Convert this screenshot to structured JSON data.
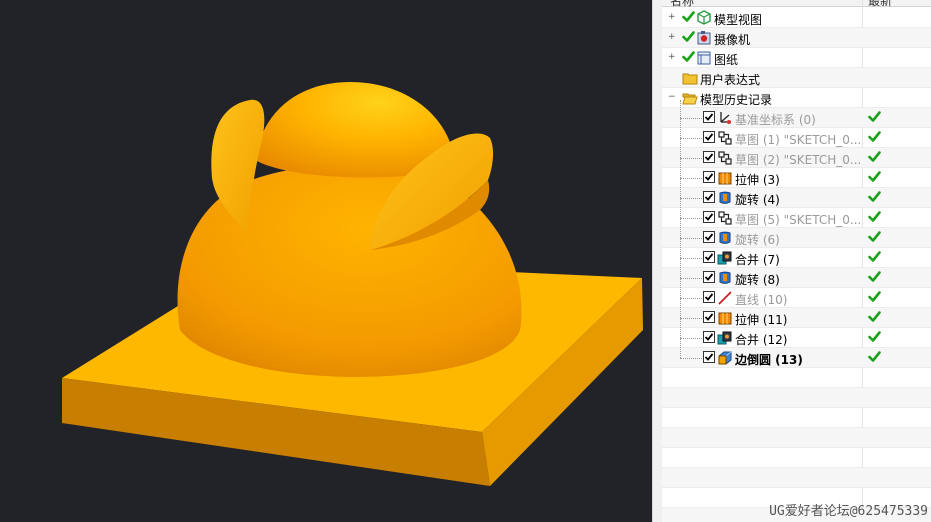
{
  "navigator": {
    "header": {
      "name_col": "名称",
      "status_col": "最新"
    },
    "top_nodes": [
      {
        "label": "模型视图",
        "icon": "model-views-icon"
      },
      {
        "label": "摄像机",
        "icon": "camera-icon"
      },
      {
        "label": "图纸",
        "icon": "drawing-icon"
      },
      {
        "label": "用户表达式",
        "icon": "folder-icon"
      },
      {
        "label": "模型历史记录",
        "icon": "folder-open-icon"
      }
    ],
    "history": [
      {
        "label": "基准坐标系 (0)",
        "icon": "datum-csys-icon",
        "gray": true
      },
      {
        "label": "草图 (1) \"SKETCH_0...",
        "icon": "sketch-icon",
        "gray": true
      },
      {
        "label": "草图 (2) \"SKETCH_0...",
        "icon": "sketch-icon",
        "gray": true
      },
      {
        "label": "拉伸 (3)",
        "icon": "extrude-icon",
        "gray": false
      },
      {
        "label": "旋转 (4)",
        "icon": "revolve-icon",
        "gray": false
      },
      {
        "label": "草图 (5) \"SKETCH_0...",
        "icon": "sketch-icon",
        "gray": true
      },
      {
        "label": "旋转 (6)",
        "icon": "revolve-icon",
        "gray": true
      },
      {
        "label": "合并 (7)",
        "icon": "unite-icon",
        "gray": false
      },
      {
        "label": "旋转 (8)",
        "icon": "revolve-icon",
        "gray": false
      },
      {
        "label": "直线 (10)",
        "icon": "line-icon",
        "gray": true
      },
      {
        "label": "拉伸 (11)",
        "icon": "extrude-icon",
        "gray": false
      },
      {
        "label": "合并 (12)",
        "icon": "unite-icon",
        "gray": false
      },
      {
        "label": "边倒圆 (13)",
        "icon": "edge-blend-icon",
        "gray": false,
        "bold": true
      }
    ]
  },
  "watermark": "UG爱好者论坛@625475339",
  "colors": {
    "viewport_bg": "#212328",
    "model": "#f5a800",
    "check_green": "#1aa31a"
  }
}
